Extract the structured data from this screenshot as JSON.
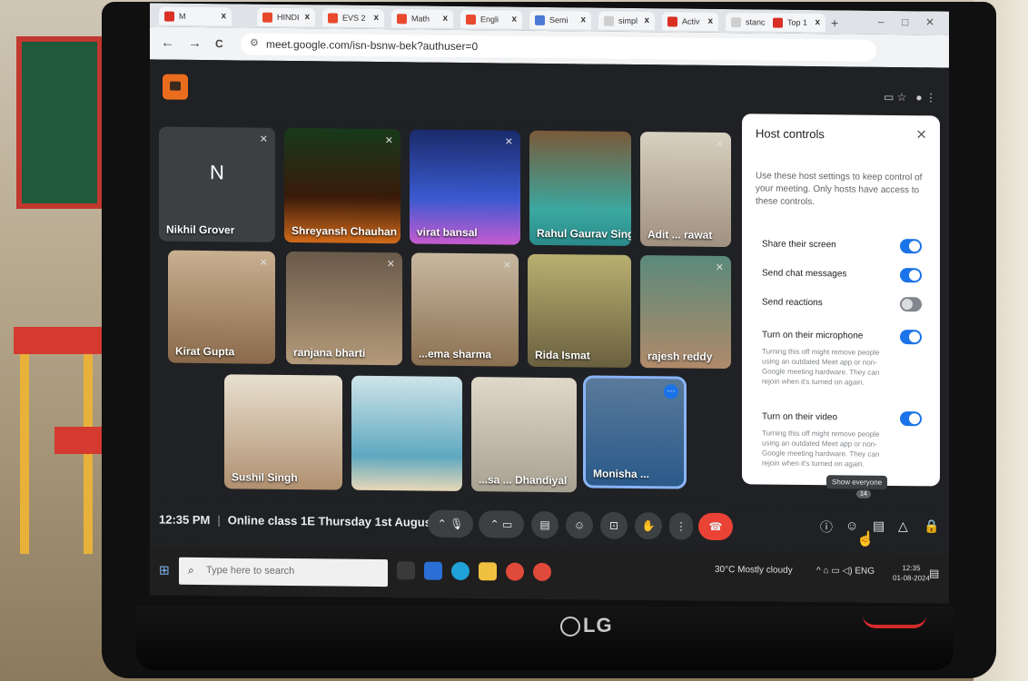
{
  "browser": {
    "tabs": [
      {
        "label": "M",
        "color": "#d93025"
      },
      {
        "label": "HINDI",
        "color": "#e8492d"
      },
      {
        "label": "EVS 2",
        "color": "#e8492d"
      },
      {
        "label": "Math",
        "color": "#e8492d"
      },
      {
        "label": "Engli",
        "color": "#e8492d"
      },
      {
        "label": "Semi",
        "color": "#4a7ad4"
      },
      {
        "label": "simpl",
        "color": "#cfcfcf"
      },
      {
        "label": "Activ",
        "color": "#d93025"
      },
      {
        "label": "stanc",
        "color": "#cfcfcf"
      },
      {
        "label": "Top 1",
        "color": "#d93025"
      }
    ],
    "tab_close": "x",
    "new_tab": "+",
    "minimize": "–",
    "maximize": "□",
    "close": "✕",
    "back": "←",
    "forward": "→",
    "reload": "C",
    "url": "meet.google.com/isn-bsnw-bek?authuser=0"
  },
  "participants": [
    {
      "name": "Nikhil Grover",
      "initial": "N",
      "bg": "#3c4043"
    },
    {
      "name": "Shreyansh Chauhan",
      "bg": "#2a1a10"
    },
    {
      "name": "virat bansal",
      "bg": "#2a3a8a"
    },
    {
      "name": "Rahul Gaurav Singh",
      "bg": "#8a6a4a"
    },
    {
      "name": "Adit ... rawat",
      "bg": "#c8b8a0"
    },
    {
      "name": "Kirat Gupta",
      "bg": "#b69a7a"
    },
    {
      "name": "ranjana bharti",
      "bg": "#7a6a5a"
    },
    {
      "name": "...ema sharma",
      "bg": "#b4a188"
    },
    {
      "name": "Rida Ismat",
      "bg": "#8a8060"
    },
    {
      "name": "rajesh reddy",
      "bg": "#5a7a6a"
    },
    {
      "name": "Sushil Singh",
      "bg": "#a08a70"
    },
    {
      "name": "",
      "bg": "#9ec8d8"
    },
    {
      "name": "...sa ... Dhandiyal",
      "bg": "#c8c0b0"
    },
    {
      "name": "Monisha ...",
      "bg": "#6a8aaa"
    }
  ],
  "host_controls": {
    "title": "Host controls",
    "close": "✕",
    "description": "Use these host settings to keep control of your meeting. Only hosts have access to these controls.",
    "items": [
      {
        "label": "Share their screen",
        "on": true
      },
      {
        "label": "Send chat messages",
        "on": true
      },
      {
        "label": "Send reactions",
        "on": false
      },
      {
        "label": "Turn on their microphone",
        "on": true,
        "note": "Turning this off might remove people using an outdated Meet app or non-Google meeting hardware. They can rejoin when it's turned on again."
      },
      {
        "label": "Turn on their video",
        "on": true,
        "note": "Turning this off might remove people using an outdated Meet app or non-Google meeting hardware. They can rejoin when it's turned on again."
      }
    ]
  },
  "meeting": {
    "time": "12:35 PM",
    "separator": "|",
    "title": "Online class 1E Thursday 1st August",
    "tooltip": "Show everyone",
    "people_count": "14"
  },
  "taskbar": {
    "search_placeholder": "Type here to search",
    "weather": "30°C Mostly cloudy",
    "tray": "^ ⌂ ▭ ◁) ENG",
    "time": "12:35",
    "date": "01-08-2024"
  },
  "monitor_brand": "LG"
}
